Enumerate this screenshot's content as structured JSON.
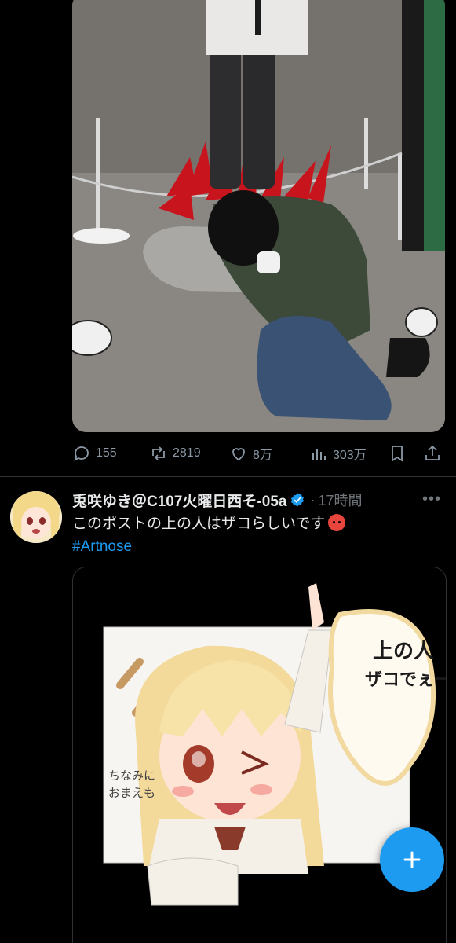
{
  "post1": {
    "actions": {
      "replies": "155",
      "reposts": "2819",
      "likes": "8万",
      "views": "303万"
    }
  },
  "post2": {
    "author_name": "兎咲ゆき＠C107火曜日西そ-05a",
    "separator": "·",
    "time": "17時間",
    "more": "•••",
    "text": "このポストの上の人はザコらしいです",
    "emoji": "angry-face-emoji",
    "hashtag": "#Artnose",
    "image": {
      "speech_line1": "上の人",
      "speech_line2": "ザコでぇーす!",
      "side_text_line1": "ちなみに",
      "side_text_line2": "おまえも"
    }
  },
  "colors": {
    "accent": "#1d9bf0",
    "muted": "#71767b",
    "text": "#e7e9ea",
    "background": "#000000"
  },
  "fab": {
    "icon": "plus-icon"
  }
}
